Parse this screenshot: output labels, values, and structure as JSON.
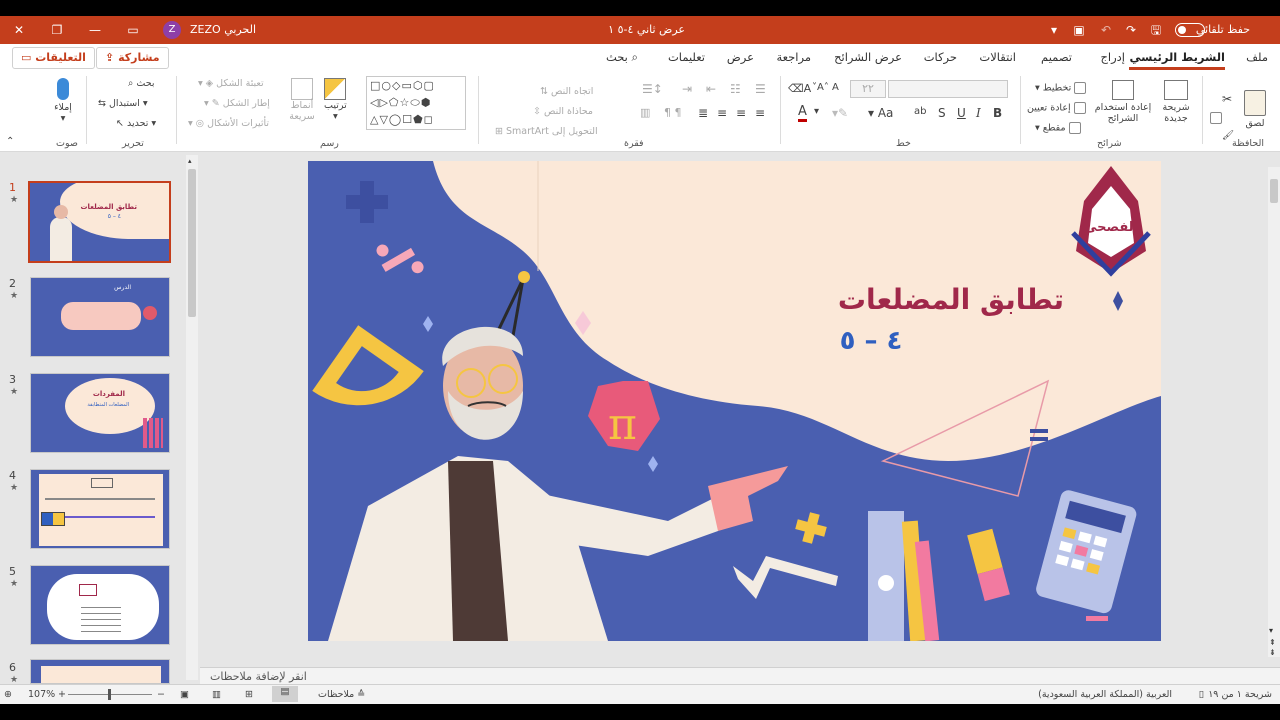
{
  "titlebar": {
    "document_title": "عرض ثاني ٤-٥ ١",
    "user_name": "ZEZO الحربي",
    "user_initial": "Z",
    "autosave_label": "حفظ تلقائي",
    "close": "✕",
    "restore": "❐",
    "minimize": "—",
    "ribbon_display": "▭"
  },
  "tabs": {
    "items": [
      "ملف",
      "الشريط الرئيسي",
      "إدراج",
      "تصميم",
      "انتقالات",
      "حركات",
      "عرض الشرائح",
      "مراجعة",
      "عرض",
      "تعليمات"
    ],
    "active": "الشريط الرئيسي",
    "search": "بحث",
    "share": "مشاركة",
    "comments": "التعليقات"
  },
  "ribbon": {
    "clipboard": {
      "label": "الحافظة",
      "paste": "لصق"
    },
    "slides": {
      "label": "شرائح",
      "new_slide": "شريحة جديدة",
      "reuse": "إعادة استخدام الشرائح",
      "layout": "تخطيط",
      "reset": "إعادة تعيين",
      "section": "مقطع"
    },
    "font": {
      "label": "خط",
      "bold": "B",
      "italic": "I",
      "underline": "U",
      "strike": "S",
      "aa": "Aa",
      "font_color": "A",
      "size": "٢٢"
    },
    "paragraph": {
      "label": "فقرة",
      "text_direction": "اتجاه النص",
      "align_text": "محاذاة النص",
      "smartart": "التحويل إلى SmartArt"
    },
    "drawing": {
      "label": "رسم",
      "arrange": "ترتيب",
      "quick_styles": "أنماط سريعة",
      "shape_fill": "تعبئة الشكل",
      "shape_outline": "إطار الشكل",
      "shape_effects": "تأثيرات الأشكال"
    },
    "editing": {
      "label": "تحرير",
      "find": "بحث",
      "replace": "استبدال",
      "select": "تحديد"
    },
    "voice": {
      "label": "صوت",
      "dictate": "إملاء"
    }
  },
  "thumbnails": [
    {
      "num": "1",
      "title": "تطابق المضلعات",
      "sub": "٤ – ٥"
    },
    {
      "num": "2",
      "title": "الدرس",
      "sub": ""
    },
    {
      "num": "3",
      "title": "المفردات",
      "sub": "المضلعات المتطابقة"
    },
    {
      "num": "4",
      "title": "",
      "sub": ""
    },
    {
      "num": "5",
      "title": "",
      "sub": ""
    },
    {
      "num": "6",
      "title": "",
      "sub": ""
    }
  ],
  "slide": {
    "title": "تطابق المضلعات",
    "subtitle": "٤ – ٥",
    "logo_text": "مدارس الفصحى الأهلية",
    "pi": "π"
  },
  "notes": {
    "placeholder": "انقر لإضافة ملاحظات"
  },
  "status": {
    "slide_count": "شريحة ١ من ١٩",
    "language": "العربية (المملكة العربية السعودية)",
    "notes_btn": "ملاحظات",
    "zoom": "107%"
  },
  "colors": {
    "accent": "#c43e1c",
    "slide_blue": "#4a5fb0",
    "slide_cream": "#fbe8d8",
    "title_color": "#a0284a"
  }
}
